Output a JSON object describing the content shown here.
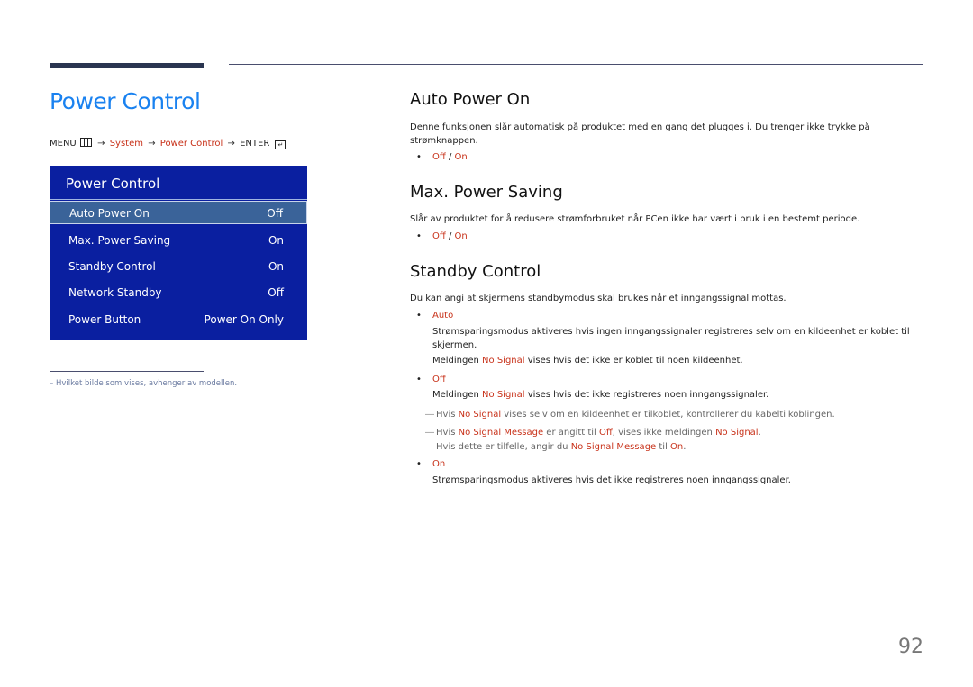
{
  "page": {
    "title": "Power Control",
    "page_number": "92"
  },
  "menu_path": {
    "menu": "MENU",
    "menu_icon": "menu-grid-icon",
    "arrow": "→",
    "system": "System",
    "power_control": "Power Control",
    "enter": "ENTER",
    "enter_icon": "enter-icon"
  },
  "osd": {
    "title": "Power Control",
    "items": [
      {
        "label": "Auto Power On",
        "value": "Off",
        "selected": true
      },
      {
        "label": "Max. Power Saving",
        "value": "On"
      },
      {
        "label": "Standby Control",
        "value": "On"
      },
      {
        "label": "Network Standby",
        "value": "Off"
      },
      {
        "label": "Power Button",
        "value": "Power On Only"
      }
    ]
  },
  "footnote": "–  Hvilket bilde som vises, avhenger av modellen.",
  "sections": {
    "auto_power_on": {
      "title": "Auto Power On",
      "description": "Denne funksjonen slår automatisk på produktet med en gang det plugges i. Du trenger ikke trykke på strømknappen.",
      "options": {
        "off": "Off",
        "sep": " / ",
        "on": "On"
      }
    },
    "max_power_saving": {
      "title": "Max. Power Saving",
      "description": "Slår av produktet for å redusere strømforbruket når PCen ikke har vært i bruk i en bestemt periode.",
      "options": {
        "off": "Off",
        "sep": " / ",
        "on": "On"
      }
    },
    "standby_control": {
      "title": "Standby Control",
      "description": "Du kan angi at skjermens standbymodus skal brukes når et inngangssignal mottas.",
      "auto": {
        "label": "Auto",
        "text1": "Strømsparingsmodus aktiveres hvis ingen inngangssignaler registreres selv om en kildeenhet er koblet til skjermen.",
        "text2_pre": "Meldingen ",
        "text2_hl": "No Signal",
        "text2_post": " vises hvis det ikke er koblet til noen kildeenhet."
      },
      "off": {
        "label": "Off",
        "text_pre": "Meldingen ",
        "text_hl": "No Signal",
        "text_post": " vises hvis det ikke registreres noen inngangssignaler."
      },
      "note1": {
        "dash": "―",
        "pre": "Hvis ",
        "hl": "No Signal",
        "post": " vises selv om en kildeenhet er tilkoblet, kontrollerer du kabeltilkoblingen."
      },
      "note2": {
        "dash": "―",
        "p1": "Hvis ",
        "h1": "No Signal Message",
        "p2": " er angitt til ",
        "h2": "Off",
        "p3": ", vises ikke meldingen ",
        "h3": "No Signal",
        "p4": ".",
        "line2_p1": "Hvis dette er tilfelle, angir du ",
        "line2_h1": "No Signal Message",
        "line2_p2": " til ",
        "line2_h2": "On",
        "line2_p3": "."
      },
      "on": {
        "label": "On",
        "text": "Strømsparingsmodus aktiveres hvis det ikke registreres noen inngangssignaler."
      }
    }
  },
  "colors": {
    "accent_blue": "#1a82f0",
    "highlight_red": "#c8321a",
    "osd_background": "#0a1fa0",
    "osd_selected": "#3a6399"
  }
}
